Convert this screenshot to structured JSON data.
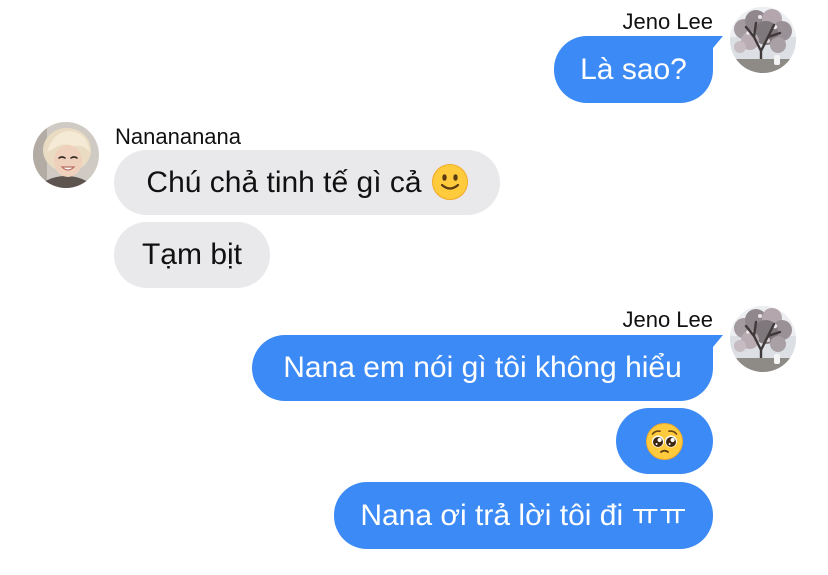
{
  "colors": {
    "outgoing_bubble": "#3c8af5",
    "incoming_bubble": "#e9e9eb",
    "background": "#ffffff",
    "sender_name": "#111111"
  },
  "conversation": {
    "groups": [
      {
        "sender": "Jeno Lee",
        "avatar_icon": "tree-photo-avatar",
        "messages": [
          {
            "text": "Là sao?"
          }
        ]
      },
      {
        "sender": "Nanananana",
        "avatar_icon": "person-photo-avatar",
        "messages": [
          {
            "text": "Chú chả tinh tế gì cả",
            "emoji_icon": "slightly-smiling-face"
          },
          {
            "text": "Tạm bịt"
          }
        ]
      },
      {
        "sender": "Jeno Lee",
        "avatar_icon": "tree-photo-avatar",
        "messages": [
          {
            "text": "Nana em nói gì tôi không hiểu"
          },
          {
            "emoji_icon": "pleading-face"
          },
          {
            "text": "Nana ơi trả lời tôi đi ㅠㅠ"
          }
        ]
      }
    ]
  }
}
